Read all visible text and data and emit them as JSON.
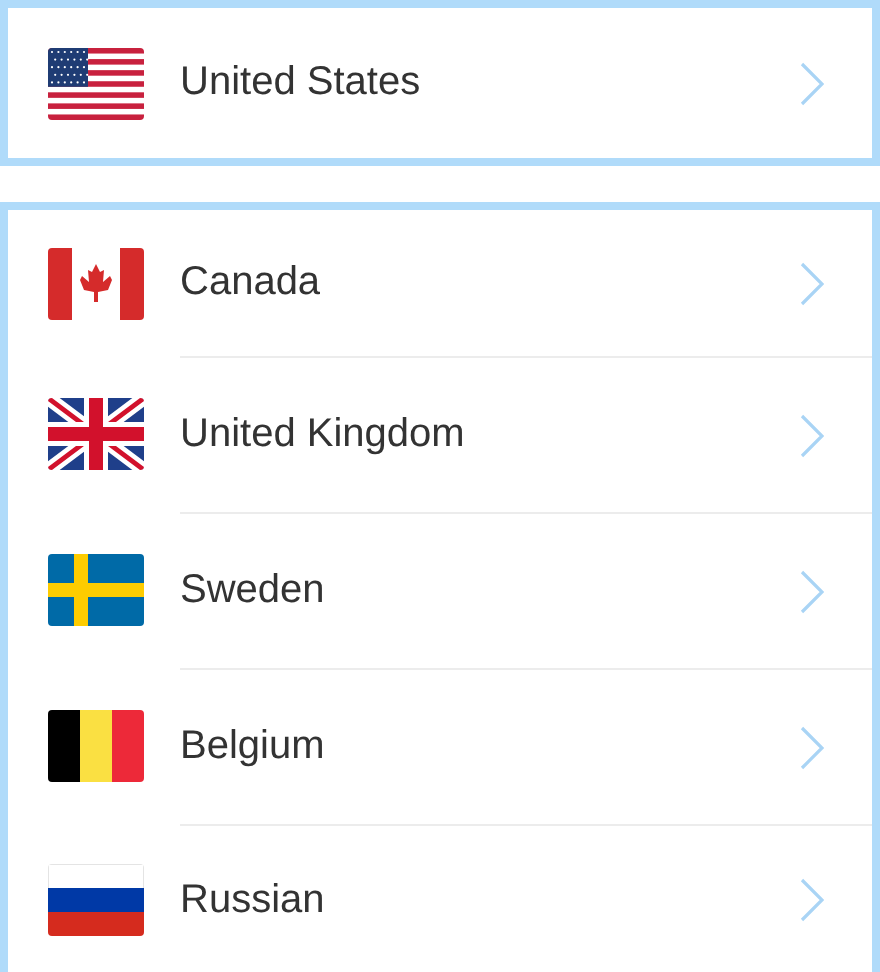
{
  "groups": [
    {
      "items": [
        {
          "label": "United States",
          "kind": "us"
        }
      ]
    },
    {
      "items": [
        {
          "label": "Canada",
          "kind": "ca"
        },
        {
          "label": "United Kingdom",
          "kind": "gb"
        },
        {
          "label": "Sweden",
          "kind": "se"
        },
        {
          "label": "Belgium",
          "kind": "be"
        },
        {
          "label": "Russian",
          "kind": "ru"
        }
      ]
    }
  ]
}
